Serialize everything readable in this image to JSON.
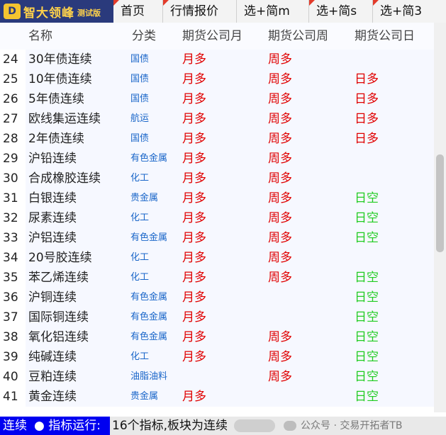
{
  "app": {
    "logo_text": "智大领峰",
    "logo_sub": "测试版",
    "logo_badge": "D"
  },
  "tabs": [
    {
      "label": "首页"
    },
    {
      "label": "行情报价"
    },
    {
      "label": "选+简m"
    },
    {
      "label": "选+简s"
    },
    {
      "label": "选+简3"
    }
  ],
  "columns": {
    "name": "名称",
    "category": "分类",
    "month": "期货公司月",
    "week": "期货公司周",
    "day": "期货公司日"
  },
  "colors": {
    "long": "#e00000",
    "short": "#22cc22",
    "category": "#1a66c9",
    "status_block_bg": "#0000f0"
  },
  "rows": [
    {
      "idx": "24",
      "name": "30年债连续",
      "cat": "国债",
      "month": "月多",
      "week": "周多",
      "day": ""
    },
    {
      "idx": "25",
      "name": "10年债连续",
      "cat": "国债",
      "month": "月多",
      "week": "周多",
      "day": "日多"
    },
    {
      "idx": "26",
      "name": "5年债连续",
      "cat": "国债",
      "month": "月多",
      "week": "周多",
      "day": "日多"
    },
    {
      "idx": "27",
      "name": "欧线集运连续",
      "cat": "航运",
      "month": "月多",
      "week": "周多",
      "day": "日多"
    },
    {
      "idx": "28",
      "name": "2年债连续",
      "cat": "国债",
      "month": "月多",
      "week": "周多",
      "day": "日多"
    },
    {
      "idx": "29",
      "name": "沪铅连续",
      "cat": "有色金属",
      "month": "月多",
      "week": "周多",
      "day": ""
    },
    {
      "idx": "30",
      "name": "合成橡胶连续",
      "cat": "化工",
      "month": "月多",
      "week": "周多",
      "day": ""
    },
    {
      "idx": "31",
      "name": "白银连续",
      "cat": "贵金属",
      "month": "月多",
      "week": "周多",
      "day": "日空"
    },
    {
      "idx": "32",
      "name": "尿素连续",
      "cat": "化工",
      "month": "月多",
      "week": "周多",
      "day": "日空"
    },
    {
      "idx": "33",
      "name": "沪铝连续",
      "cat": "有色金属",
      "month": "月多",
      "week": "周多",
      "day": "日空"
    },
    {
      "idx": "34",
      "name": "20号胶连续",
      "cat": "化工",
      "month": "月多",
      "week": "周多",
      "day": ""
    },
    {
      "idx": "35",
      "name": "苯乙烯连续",
      "cat": "化工",
      "month": "月多",
      "week": "周多",
      "day": "日空"
    },
    {
      "idx": "36",
      "name": "沪铜连续",
      "cat": "有色金属",
      "month": "月多",
      "week": "",
      "day": "日空"
    },
    {
      "idx": "37",
      "name": "国际铜连续",
      "cat": "有色金属",
      "month": "月多",
      "week": "",
      "day": "日空"
    },
    {
      "idx": "38",
      "name": "氧化铝连续",
      "cat": "有色金属",
      "month": "月多",
      "week": "周多",
      "day": "日空"
    },
    {
      "idx": "39",
      "name": "纯碱连续",
      "cat": "化工",
      "month": "月多",
      "week": "周多",
      "day": "日空"
    },
    {
      "idx": "40",
      "name": "豆粕连续",
      "cat": "油脂油料",
      "month": "",
      "week": "周多",
      "day": "日空"
    },
    {
      "idx": "41",
      "name": "黄金连续",
      "cat": "贵金属",
      "month": "月多",
      "week": "",
      "day": "日空"
    }
  ],
  "status": {
    "block": "连续",
    "dot": "●",
    "running": "指标运行:",
    "message": "16个指标,板块为连续",
    "watermark": "公众号 · 交易开拓者TB"
  }
}
